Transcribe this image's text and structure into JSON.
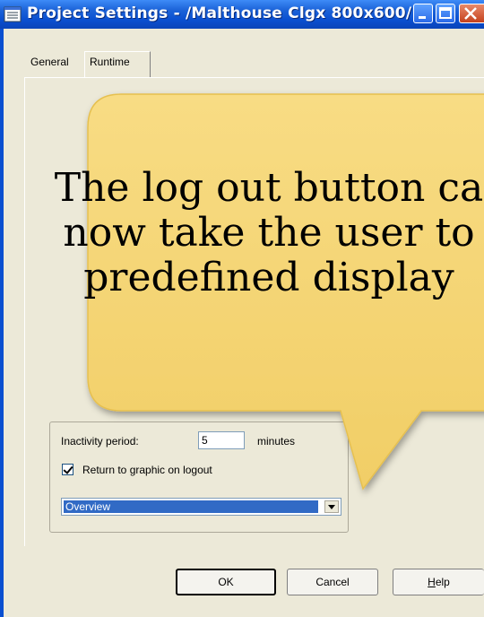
{
  "window": {
    "title": "Project Settings - /Malthouse Clgx 800x600/",
    "accent_color": "#0a4fd0",
    "title_icon": "project-icon"
  },
  "tabs": [
    {
      "label": "General"
    },
    {
      "label": "Runtime",
      "selected": true
    }
  ],
  "runtime": {
    "inactivity_label": "Inactivity period:",
    "inactivity_value": "5",
    "minutes_label": "minutes",
    "return_checkbox_label": "Return to graphic on logout",
    "return_checked": true,
    "graphic_selected": "Overview"
  },
  "buttons": {
    "ok": "OK",
    "cancel": "Cancel",
    "help_mnemonic": "H",
    "help_rest": "elp"
  },
  "callout": {
    "lines": [
      "The log out button ca",
      "now take the user to",
      "predefined display"
    ],
    "fill_color": "#f5d778"
  }
}
